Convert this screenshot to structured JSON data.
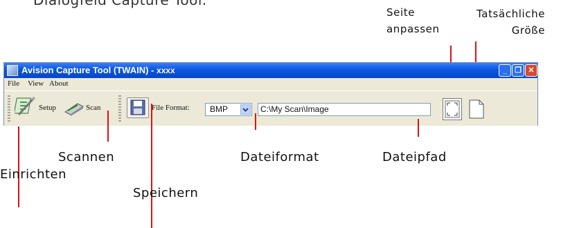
{
  "heading": "Dialogfeld Capture Tool.",
  "callouts": {
    "seite_anpassen": "Seite\nanpassen",
    "tatsaechliche_groesse": "Tatsächliche\nGröße",
    "scannen": "Scannen",
    "einrichten": "Einrichten",
    "speichern": "Speichern",
    "dateiformat": "Dateiformat",
    "dateipfad": "Dateipfad"
  },
  "window": {
    "title": "Avision Capture Tool (TWAIN) -",
    "title_suffix": "xxxx",
    "menu": [
      "File",
      "View",
      "About"
    ],
    "toolbar": {
      "setup_label": "Setup",
      "scan_label": "Scan",
      "file_format_label": "File Format:",
      "file_format_value": "BMP",
      "file_path_value": "C:\\My Scan\\Image"
    }
  },
  "colors": {
    "callout_line": "#dd1111",
    "titlebar": "#0a56e0"
  },
  "icons": [
    "app-icon",
    "setup-icon",
    "scan-icon",
    "save-icon",
    "fit-page-icon",
    "actual-size-icon",
    "minimize-icon",
    "maximize-icon",
    "close-icon",
    "chevron-down-icon"
  ]
}
